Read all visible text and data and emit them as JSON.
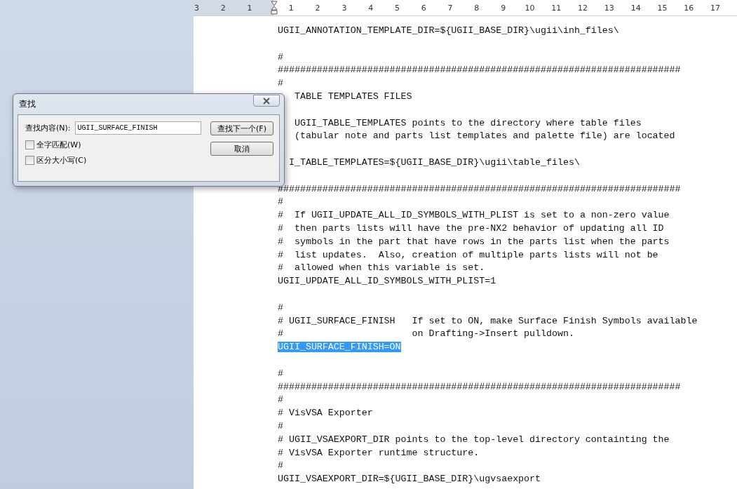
{
  "ruler": {
    "left_marks": [
      "3",
      "2",
      "1"
    ],
    "right_marks": [
      "1",
      "2",
      "3",
      "4",
      "5",
      "6",
      "7",
      "8",
      "9",
      "10",
      "11",
      "12",
      "13",
      "14",
      "15",
      "16",
      "17"
    ]
  },
  "document": {
    "lines": [
      {
        "kind": "text",
        "text": "UGII_ANNOTATION_TEMPLATE_DIR=${UGII_BASE_DIR}\\ugii\\inh_files\\"
      },
      {
        "kind": "blank"
      },
      {
        "kind": "text",
        "text": "#"
      },
      {
        "kind": "text",
        "text": "########################################################################"
      },
      {
        "kind": "text",
        "text": "#"
      },
      {
        "kind": "covered",
        "text": " TABLE TEMPLATES FILES"
      },
      {
        "kind": "blank"
      },
      {
        "kind": "covered",
        "text": " UGII_TABLE_TEMPLATES points to the directory where table files"
      },
      {
        "kind": "covered",
        "text": " (tabular note and parts list templates and palette file) are located"
      },
      {
        "kind": "blank"
      },
      {
        "kind": "covered",
        "text": "I_TABLE_TEMPLATES=${UGII_BASE_DIR}\\ugii\\table_files\\"
      },
      {
        "kind": "blank"
      },
      {
        "kind": "text",
        "text": "########################################################################"
      },
      {
        "kind": "text",
        "text": "#"
      },
      {
        "kind": "text",
        "text": "#  If UGII_UPDATE_ALL_ID_SYMBOLS_WITH_PLIST is set to a non-zero value"
      },
      {
        "kind": "text",
        "text": "#  then parts lists will have the pre-NX2 behavior of updating all ID"
      },
      {
        "kind": "text",
        "text": "#  symbols in the part that have rows in the parts list when the parts"
      },
      {
        "kind": "text",
        "text": "#  list updates.  Also, creation of multiple parts lists will not be"
      },
      {
        "kind": "text",
        "text": "#  allowed when this variable is set."
      },
      {
        "kind": "text",
        "text": "UGII_UPDATE_ALL_ID_SYMBOLS_WITH_PLIST=1"
      },
      {
        "kind": "blank"
      },
      {
        "kind": "text",
        "text": "#"
      },
      {
        "kind": "text",
        "text": "# UGII_SURFACE_FINISH   If set to ON, make Surface Finish Symbols available"
      },
      {
        "kind": "text",
        "text": "#                       on Drafting->Insert pulldown."
      },
      {
        "kind": "selected",
        "text": "UGII_SURFACE_FINISH=ON"
      },
      {
        "kind": "blank"
      },
      {
        "kind": "text",
        "text": "#"
      },
      {
        "kind": "text",
        "text": "########################################################################"
      },
      {
        "kind": "text",
        "text": "#"
      },
      {
        "kind": "text",
        "text": "# VisVSA Exporter"
      },
      {
        "kind": "text",
        "text": "#"
      },
      {
        "kind": "text",
        "text": "# UGII_VSAEXPORT_DIR points to the top-level directory containting the"
      },
      {
        "kind": "text",
        "text": "# VisVSA Exporter runtime structure."
      },
      {
        "kind": "text",
        "text": "#"
      },
      {
        "kind": "text",
        "text": "UGII_VSAEXPORT_DIR=${UGII_BASE_DIR}\\ugvsaexport"
      }
    ]
  },
  "find_dialog": {
    "title": "查找",
    "label": "查找内容(N):",
    "value": "UGII_SURFACE_FINISH",
    "buttons": [
      "查找下一个(F)",
      "取消"
    ],
    "options": [
      {
        "label": "全字匹配(W)",
        "checked": false
      },
      {
        "label": "区分大小写(C)",
        "checked": false
      }
    ]
  }
}
